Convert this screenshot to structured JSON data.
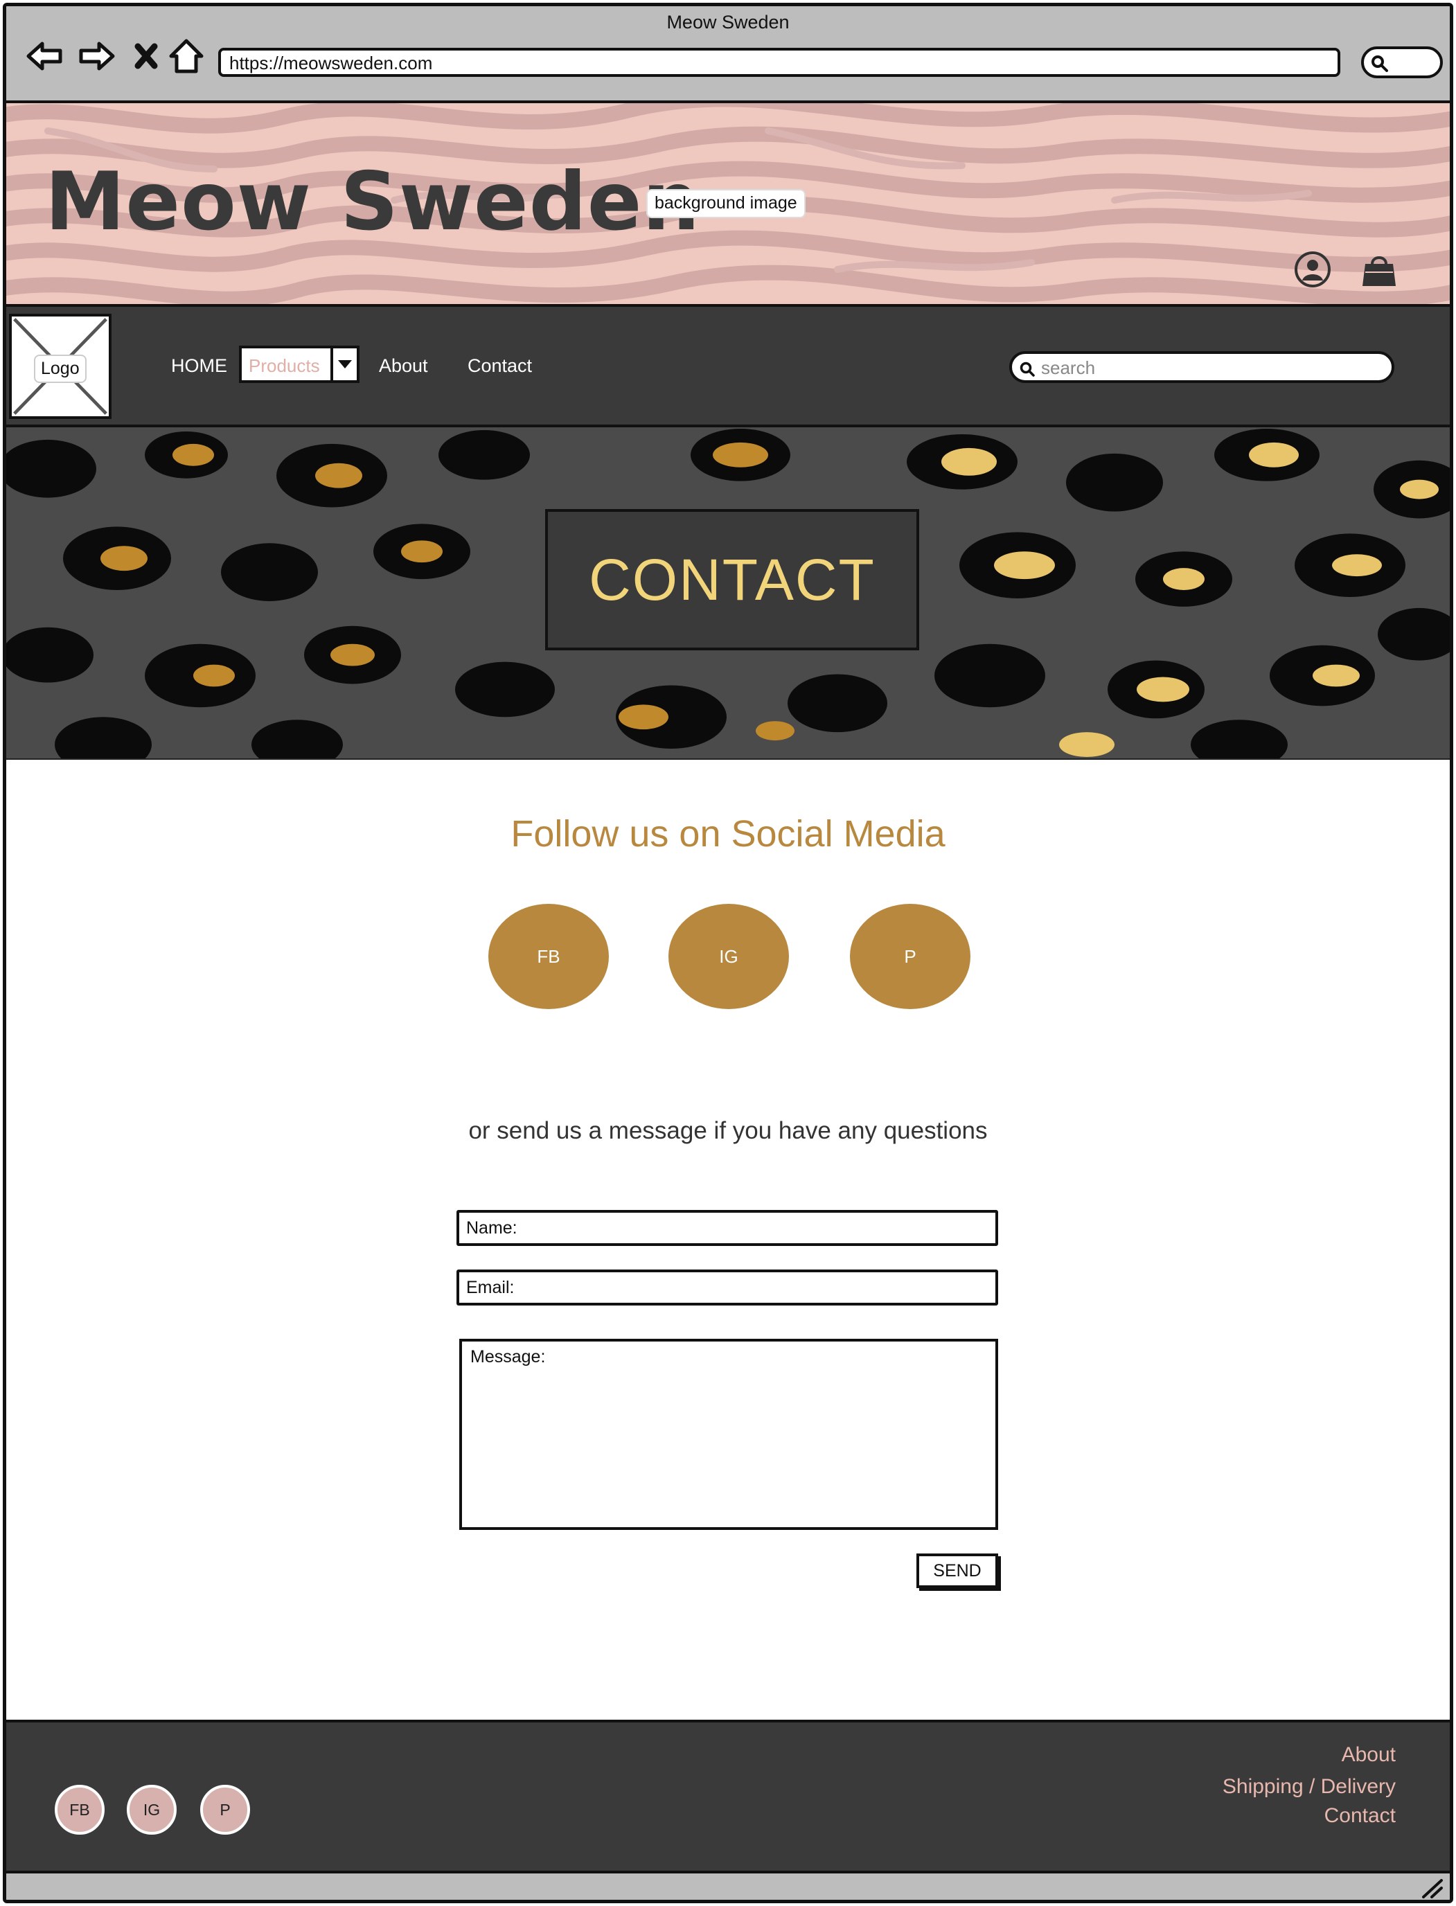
{
  "browser": {
    "window_title": "Meow Sweden",
    "url": "https://meowsweden.com",
    "icons": [
      "back-icon",
      "forward-icon",
      "close-icon",
      "home-icon",
      "search-icon"
    ]
  },
  "header": {
    "site_title": "Meow Sweden",
    "background_tag": "background image",
    "icons": [
      "user-icon",
      "shopping-bag-icon"
    ],
    "colors": {
      "background": "#efc9c0",
      "stripes": "#d3aaa6"
    }
  },
  "nav": {
    "logo_label": "Logo",
    "home": "HOME",
    "products": "Products",
    "about": "About",
    "contact": "Contact",
    "search_placeholder": "search",
    "colors": {
      "background": "#3a3a3a",
      "products_text": "#e0afa7"
    }
  },
  "hero": {
    "title": "CONTACT",
    "colors": {
      "title": "#f2d57a",
      "box": "#3a3a3a"
    }
  },
  "main": {
    "social_heading": "Follow us on Social Media",
    "social": [
      "FB",
      "IG",
      "P"
    ],
    "message_prompt": "or send us a message if you have any questions",
    "form": {
      "name_placeholder": "Name:",
      "email_placeholder": "Email:",
      "message_placeholder": "Message:",
      "send_label": "SEND"
    },
    "colors": {
      "accent": "#b7883e"
    }
  },
  "footer": {
    "social": [
      "FB",
      "IG",
      "P"
    ],
    "links": [
      "About",
      "Shipping / Delivery",
      "Contact"
    ],
    "colors": {
      "background": "#3a3a3a",
      "circle": "#d7b1ad",
      "links": "#e8b7ae"
    }
  }
}
